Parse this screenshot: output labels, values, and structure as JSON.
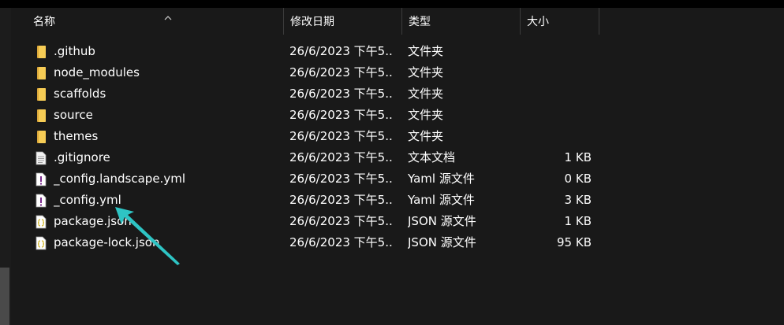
{
  "columns": {
    "name": "名称",
    "date": "修改日期",
    "type": "类型",
    "size": "大小"
  },
  "rows": [
    {
      "name": ".github",
      "date": "26/6/2023 下午5...",
      "type": "文件夹",
      "size": "",
      "icon": "folder-icon"
    },
    {
      "name": "node_modules",
      "date": "26/6/2023 下午5...",
      "type": "文件夹",
      "size": "",
      "icon": "folder-icon"
    },
    {
      "name": "scaffolds",
      "date": "26/6/2023 下午5...",
      "type": "文件夹",
      "size": "",
      "icon": "folder-icon"
    },
    {
      "name": "source",
      "date": "26/6/2023 下午5...",
      "type": "文件夹",
      "size": "",
      "icon": "folder-icon"
    },
    {
      "name": "themes",
      "date": "26/6/2023 下午5...",
      "type": "文件夹",
      "size": "",
      "icon": "folder-icon"
    },
    {
      "name": ".gitignore",
      "date": "26/6/2023 下午5...",
      "type": "文本文档",
      "size": "1 KB",
      "icon": "text-file-icon"
    },
    {
      "name": "_config.landscape.yml",
      "date": "26/6/2023 下午5...",
      "type": "Yaml 源文件",
      "size": "0 KB",
      "icon": "yaml-file-icon"
    },
    {
      "name": "_config.yml",
      "date": "26/6/2023 下午5...",
      "type": "Yaml 源文件",
      "size": "3 KB",
      "icon": "yaml-file-icon"
    },
    {
      "name": "package.json",
      "date": "26/6/2023 下午5...",
      "type": "JSON 源文件",
      "size": "1 KB",
      "icon": "json-file-icon"
    },
    {
      "name": "package-lock.json",
      "date": "26/6/2023 下午5...",
      "type": "JSON 源文件",
      "size": "95 KB",
      "icon": "json-file-icon"
    }
  ],
  "colors": {
    "background": "#191919",
    "folder": "#f0c040",
    "arrow": "#2ec4c4"
  }
}
